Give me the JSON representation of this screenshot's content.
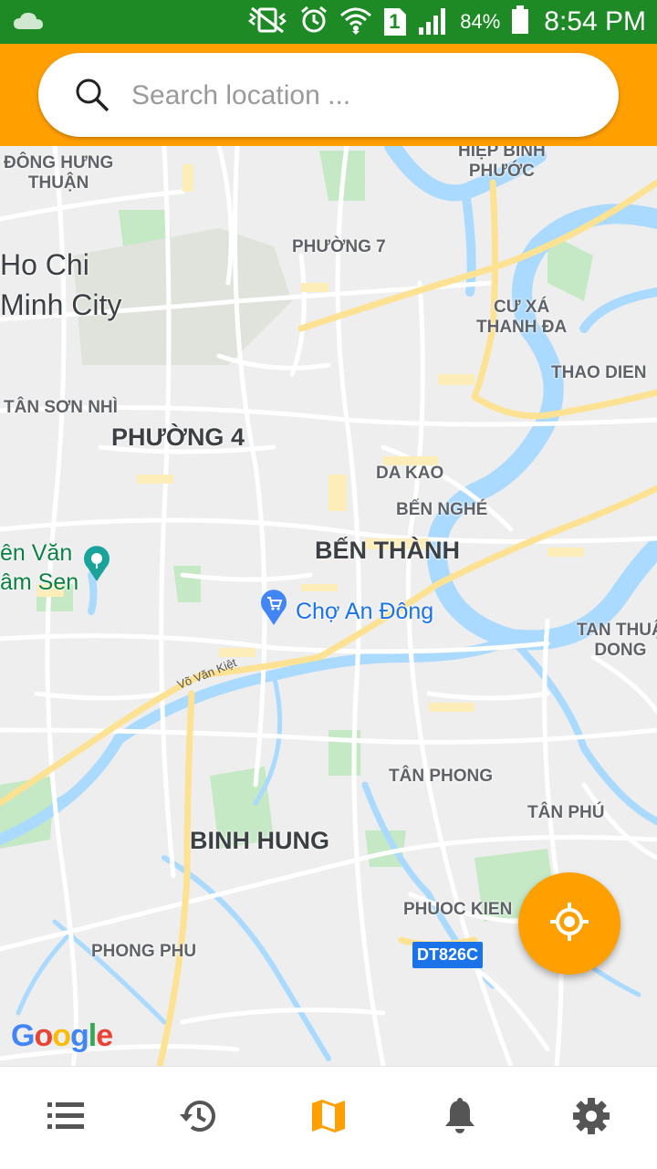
{
  "status_bar": {
    "battery_percent": "84%",
    "time": "8:54 PM",
    "sim_number": "1",
    "icons": [
      "cloud-icon",
      "vibrate-icon",
      "alarm-icon",
      "wifi-icon",
      "sim-icon",
      "signal-icon",
      "battery-icon"
    ]
  },
  "search": {
    "placeholder": "Search location ..."
  },
  "map": {
    "labels": {
      "dong_hung_thuan": "ĐÔNG HƯNG\nTHUẬN",
      "hiep_binh_phuoc": "HIỆP BÌNH\nPHƯỚC",
      "ho_chi_minh_city": "Ho Chi\nMinh City",
      "phuong_7": "PHƯỜNG 7",
      "cu_xa_thanh_da": "CƯ XÁ\nTHANH ĐA",
      "thao_dien": "THAO DIEN",
      "tan_son_nhi": "TÂN SƠN NHÌ",
      "phuong_4": "PHƯỜNG 4",
      "da_kao": "DA KAO",
      "ben_nghe": "BẾN NGHÉ",
      "ben_thanh": "BẾN THÀNH",
      "dam_sen": "ên Văn\nâm Sen",
      "cho_an_dong": "Chợ An Đông",
      "tan_thuan_dong": "TAN THUẬ\nDONG",
      "vo_van_kiet": "Võ Văn Kiệt",
      "tan_phong": "TÂN PHONG",
      "tan_phu": "TÂN PHÚ",
      "binh_hung": "BINH HUNG",
      "phuoc_kien": "PHUOC KIEN",
      "phong_phu": "PHONG PHU",
      "route_badge": "DT826C"
    },
    "google_logo": "Google",
    "colors": {
      "water": "#aadaff",
      "park": "#c5e8c5",
      "highway": "#fde293",
      "land": "#eeeeee"
    }
  },
  "fab": {
    "icon": "gps-fixed-icon",
    "color": "#ff9f00"
  },
  "bottom_nav": {
    "tabs": [
      {
        "name": "list",
        "icon": "list-icon"
      },
      {
        "name": "history",
        "icon": "history-icon"
      },
      {
        "name": "map",
        "icon": "map-icon",
        "active": true
      },
      {
        "name": "notifications",
        "icon": "bell-icon"
      },
      {
        "name": "settings",
        "icon": "gear-icon"
      }
    ],
    "active_color": "#ff9f00",
    "inactive_color": "#555555"
  },
  "header_color": "#ff9f00",
  "status_bar_color": "#1e8a26"
}
